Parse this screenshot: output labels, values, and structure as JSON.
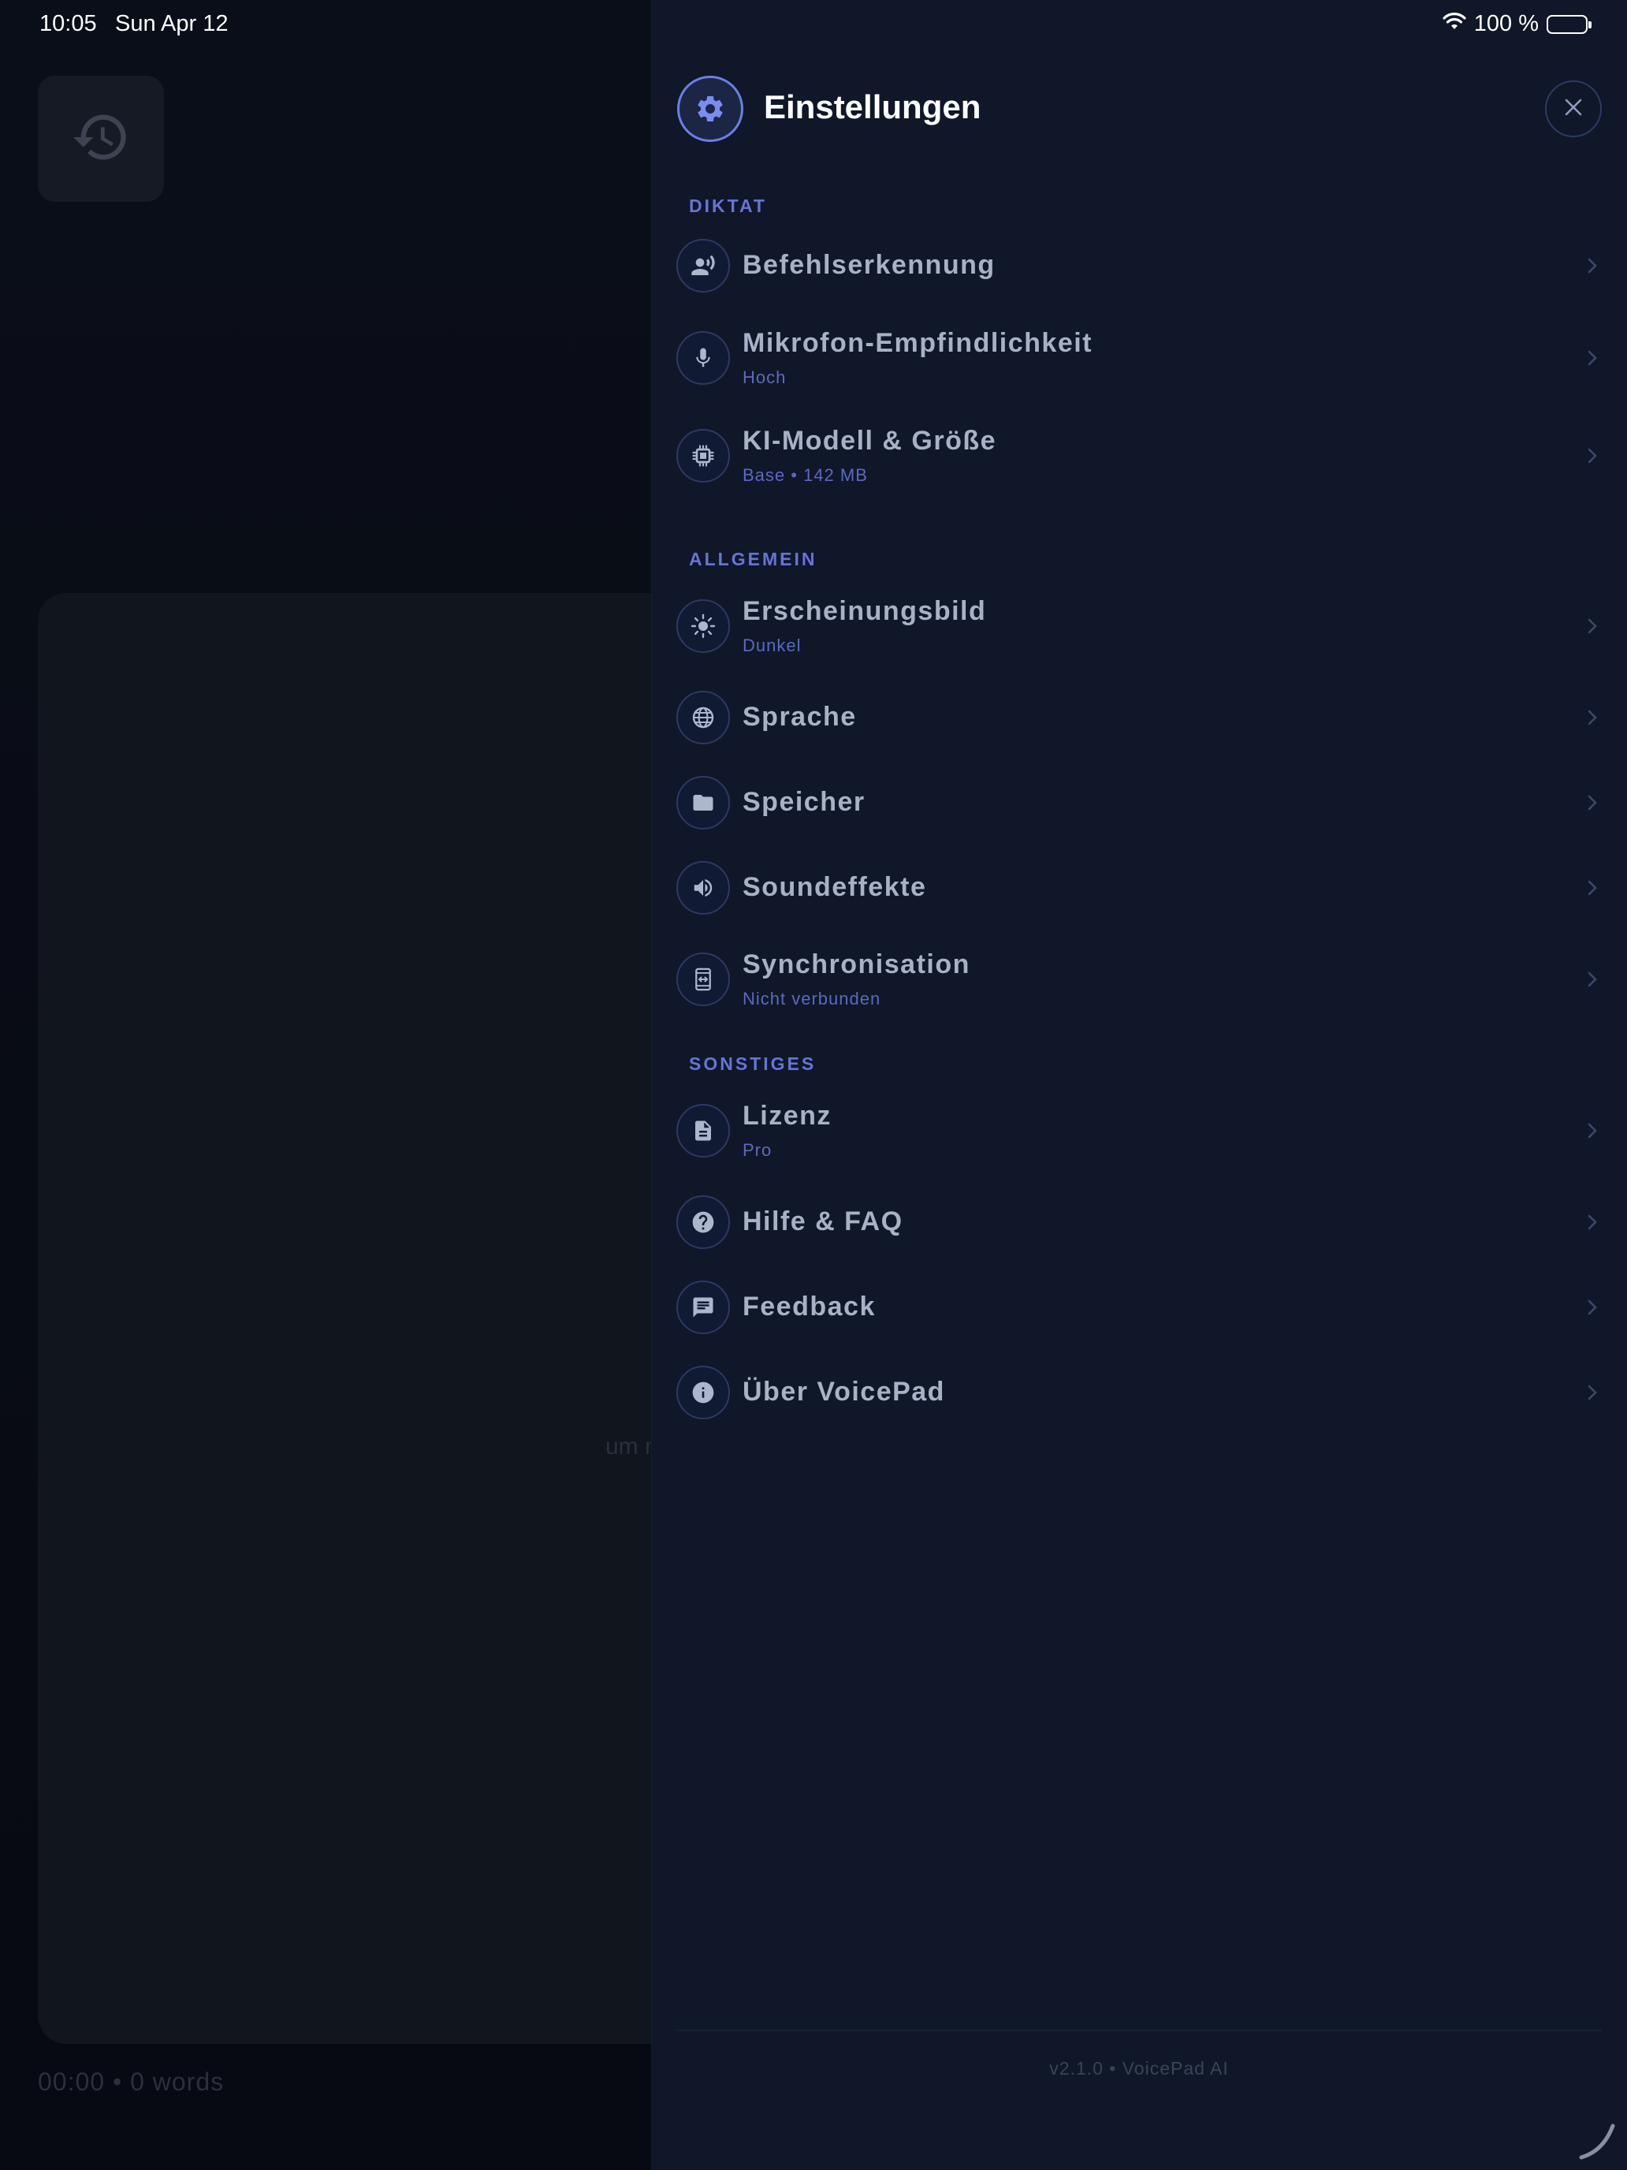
{
  "status_bar": {
    "time": "10:05",
    "date": "Sun Apr 12",
    "battery": "100 %"
  },
  "background": {
    "history_icon": "history-icon",
    "editor_hint": "um n",
    "footer_stats": "00:00 • 0 words"
  },
  "settings": {
    "title": "Einstellungen",
    "header_icon": "gear-icon",
    "close_icon": "close-icon",
    "accent_color": "#6b7fe6",
    "sections": [
      {
        "label": "DIKTAT"
      },
      {
        "label": "ALLGEMEIN"
      },
      {
        "label": "SONSTIGES"
      }
    ],
    "items": [
      {
        "title": "Befehlserkennung",
        "subtitle": "",
        "icon": "voice-person-icon"
      },
      {
        "title": "Mikrofon-Empfindlichkeit",
        "subtitle": "Hoch",
        "icon": "microphone-icon"
      },
      {
        "title": "KI-Modell & Größe",
        "subtitle": "Base • 142 MB",
        "icon": "chip-icon"
      },
      {
        "title": "Erscheinungsbild",
        "subtitle": "Dunkel",
        "icon": "sun-icon"
      },
      {
        "title": "Sprache",
        "subtitle": "",
        "icon": "globe-icon"
      },
      {
        "title": "Speicher",
        "subtitle": "",
        "icon": "folder-icon"
      },
      {
        "title": "Soundeffekte",
        "subtitle": "",
        "icon": "speaker-icon"
      },
      {
        "title": "Synchronisation",
        "subtitle": "Nicht verbunden",
        "icon": "sync-device-icon"
      },
      {
        "title": "Lizenz",
        "subtitle": "Pro",
        "icon": "document-icon"
      },
      {
        "title": "Hilfe & FAQ",
        "subtitle": "",
        "icon": "help-icon"
      },
      {
        "title": "Feedback",
        "subtitle": "",
        "icon": "chat-icon"
      },
      {
        "title": "Über VoicePad",
        "subtitle": "",
        "icon": "info-icon"
      }
    ],
    "version": "v2.1.0 • VoicePad AI"
  }
}
